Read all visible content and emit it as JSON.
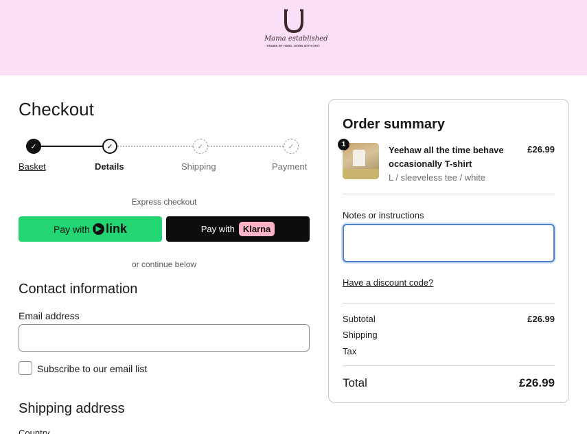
{
  "brand": {
    "logo_script": "Mama established",
    "logo_tagline": "DRAWN BY HAND. WORN WITH GRIT.",
    "header_color": "#fbdff7"
  },
  "checkout": {
    "title": "Checkout",
    "steps": [
      {
        "label": "Basket",
        "state": "done"
      },
      {
        "label": "Details",
        "state": "current"
      },
      {
        "label": "Shipping",
        "state": "pending"
      },
      {
        "label": "Payment",
        "state": "pending"
      }
    ],
    "express_label": "Express checkout",
    "pay_link": {
      "prefix": "Pay with",
      "brand": "link"
    },
    "pay_klarna": {
      "prefix": "Pay with",
      "brand": "Klarna"
    },
    "continue_label": "or continue below"
  },
  "contact": {
    "heading": "Contact information",
    "email_label": "Email address",
    "email_value": "",
    "subscribe_label": "Subscribe to our email list",
    "subscribe_checked": false
  },
  "shipping": {
    "heading": "Shipping address",
    "country_label": "Country"
  },
  "summary": {
    "title": "Order summary",
    "item": {
      "quantity": "1",
      "name": "Yeehaw all the time behave occasionally T-shirt",
      "variant": "L / sleeveless tee / white",
      "price": "£26.99"
    },
    "notes_label": "Notes or instructions",
    "notes_value": "",
    "discount_label": "Have a discount code?",
    "subtotal_label": "Subtotal",
    "subtotal_value": "£26.99",
    "shipping_label": "Shipping",
    "tax_label": "Tax",
    "total_label": "Total",
    "total_value": "£26.99"
  },
  "colors": {
    "link_green": "#24d574",
    "klarna_pink": "#ffb3c7",
    "focus_blue": "#4e82c8"
  }
}
